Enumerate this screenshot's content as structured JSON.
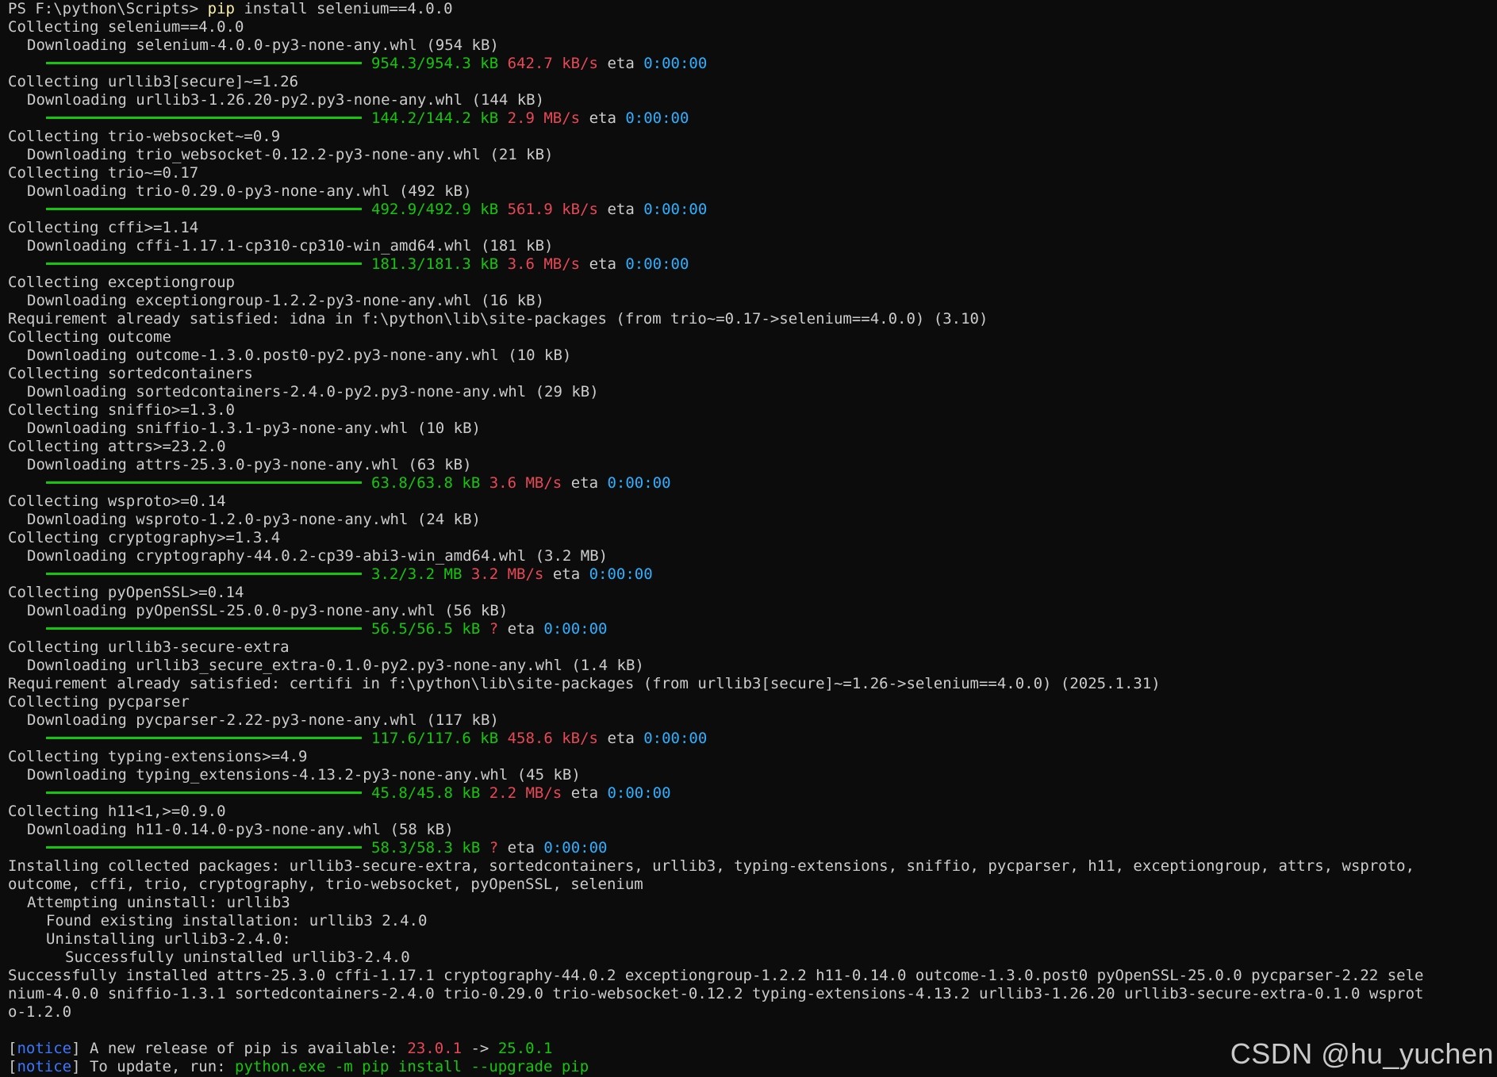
{
  "prompt": {
    "ps_prefix": "PS F:\\python\\Scripts> ",
    "command_name": "pip",
    "command_args": " install selenium==4.0.0"
  },
  "lines": [
    {
      "type": "text",
      "indent": 0,
      "text": "Collecting selenium==4.0.0"
    },
    {
      "type": "text",
      "indent": 1,
      "text": "Downloading selenium-4.0.0-py3-none-any.whl (954 kB)"
    },
    {
      "type": "progress",
      "size": "954.3/954.3 kB",
      "speed": "642.7 kB/s",
      "eta_label": "eta",
      "eta": "0:00:00"
    },
    {
      "type": "text",
      "indent": 0,
      "text": "Collecting urllib3[secure]~=1.26"
    },
    {
      "type": "text",
      "indent": 1,
      "text": "Downloading urllib3-1.26.20-py2.py3-none-any.whl (144 kB)"
    },
    {
      "type": "progress",
      "size": "144.2/144.2 kB",
      "speed": "2.9 MB/s",
      "eta_label": "eta",
      "eta": "0:00:00"
    },
    {
      "type": "text",
      "indent": 0,
      "text": "Collecting trio-websocket~=0.9"
    },
    {
      "type": "text",
      "indent": 1,
      "text": "Downloading trio_websocket-0.12.2-py3-none-any.whl (21 kB)"
    },
    {
      "type": "text",
      "indent": 0,
      "text": "Collecting trio~=0.17"
    },
    {
      "type": "text",
      "indent": 1,
      "text": "Downloading trio-0.29.0-py3-none-any.whl (492 kB)"
    },
    {
      "type": "progress",
      "size": "492.9/492.9 kB",
      "speed": "561.9 kB/s",
      "eta_label": "eta",
      "eta": "0:00:00"
    },
    {
      "type": "text",
      "indent": 0,
      "text": "Collecting cffi>=1.14"
    },
    {
      "type": "text",
      "indent": 1,
      "text": "Downloading cffi-1.17.1-cp310-cp310-win_amd64.whl (181 kB)"
    },
    {
      "type": "progress",
      "size": "181.3/181.3 kB",
      "speed": "3.6 MB/s",
      "eta_label": "eta",
      "eta": "0:00:00"
    },
    {
      "type": "text",
      "indent": 0,
      "text": "Collecting exceptiongroup"
    },
    {
      "type": "text",
      "indent": 1,
      "text": "Downloading exceptiongroup-1.2.2-py3-none-any.whl (16 kB)"
    },
    {
      "type": "text",
      "indent": 0,
      "text": "Requirement already satisfied: idna in f:\\python\\lib\\site-packages (from trio~=0.17->selenium==4.0.0) (3.10)"
    },
    {
      "type": "text",
      "indent": 0,
      "text": "Collecting outcome"
    },
    {
      "type": "text",
      "indent": 1,
      "text": "Downloading outcome-1.3.0.post0-py2.py3-none-any.whl (10 kB)"
    },
    {
      "type": "text",
      "indent": 0,
      "text": "Collecting sortedcontainers"
    },
    {
      "type": "text",
      "indent": 1,
      "text": "Downloading sortedcontainers-2.4.0-py2.py3-none-any.whl (29 kB)"
    },
    {
      "type": "text",
      "indent": 0,
      "text": "Collecting sniffio>=1.3.0"
    },
    {
      "type": "text",
      "indent": 1,
      "text": "Downloading sniffio-1.3.1-py3-none-any.whl (10 kB)"
    },
    {
      "type": "text",
      "indent": 0,
      "text": "Collecting attrs>=23.2.0"
    },
    {
      "type": "text",
      "indent": 1,
      "text": "Downloading attrs-25.3.0-py3-none-any.whl (63 kB)"
    },
    {
      "type": "progress",
      "size": "63.8/63.8 kB",
      "speed": "3.6 MB/s",
      "eta_label": "eta",
      "eta": "0:00:00"
    },
    {
      "type": "text",
      "indent": 0,
      "text": "Collecting wsproto>=0.14"
    },
    {
      "type": "text",
      "indent": 1,
      "text": "Downloading wsproto-1.2.0-py3-none-any.whl (24 kB)"
    },
    {
      "type": "text",
      "indent": 0,
      "text": "Collecting cryptography>=1.3.4"
    },
    {
      "type": "text",
      "indent": 1,
      "text": "Downloading cryptography-44.0.2-cp39-abi3-win_amd64.whl (3.2 MB)"
    },
    {
      "type": "progress",
      "size": "3.2/3.2 MB",
      "speed": "3.2 MB/s",
      "eta_label": "eta",
      "eta": "0:00:00"
    },
    {
      "type": "text",
      "indent": 0,
      "text": "Collecting pyOpenSSL>=0.14"
    },
    {
      "type": "text",
      "indent": 1,
      "text": "Downloading pyOpenSSL-25.0.0-py3-none-any.whl (56 kB)"
    },
    {
      "type": "progress",
      "size": "56.5/56.5 kB",
      "speed": "?",
      "eta_label": "eta",
      "eta": "0:00:00"
    },
    {
      "type": "text",
      "indent": 0,
      "text": "Collecting urllib3-secure-extra"
    },
    {
      "type": "text",
      "indent": 1,
      "text": "Downloading urllib3_secure_extra-0.1.0-py2.py3-none-any.whl (1.4 kB)"
    },
    {
      "type": "text",
      "indent": 0,
      "text": "Requirement already satisfied: certifi in f:\\python\\lib\\site-packages (from urllib3[secure]~=1.26->selenium==4.0.0) (2025.1.31)"
    },
    {
      "type": "text",
      "indent": 0,
      "text": "Collecting pycparser"
    },
    {
      "type": "text",
      "indent": 1,
      "text": "Downloading pycparser-2.22-py3-none-any.whl (117 kB)"
    },
    {
      "type": "progress",
      "size": "117.6/117.6 kB",
      "speed": "458.6 kB/s",
      "eta_label": "eta",
      "eta": "0:00:00"
    },
    {
      "type": "text",
      "indent": 0,
      "text": "Collecting typing-extensions>=4.9"
    },
    {
      "type": "text",
      "indent": 1,
      "text": "Downloading typing_extensions-4.13.2-py3-none-any.whl (45 kB)"
    },
    {
      "type": "progress",
      "size": "45.8/45.8 kB",
      "speed": "2.2 MB/s",
      "eta_label": "eta",
      "eta": "0:00:00"
    },
    {
      "type": "text",
      "indent": 0,
      "text": "Collecting h11<1,>=0.9.0"
    },
    {
      "type": "text",
      "indent": 1,
      "text": "Downloading h11-0.14.0-py3-none-any.whl (58 kB)"
    },
    {
      "type": "progress",
      "size": "58.3/58.3 kB",
      "speed": "?",
      "eta_label": "eta",
      "eta": "0:00:00"
    },
    {
      "type": "text",
      "indent": 0,
      "text": "Installing collected packages: urllib3-secure-extra, sortedcontainers, urllib3, typing-extensions, sniffio, pycparser, h11, exceptiongroup, attrs, wsproto,"
    },
    {
      "type": "text",
      "indent": 0,
      "text": "outcome, cffi, trio, cryptography, trio-websocket, pyOpenSSL, selenium"
    },
    {
      "type": "text",
      "indent": 1,
      "text": "Attempting uninstall: urllib3"
    },
    {
      "type": "text",
      "indent": 2,
      "text": "Found existing installation: urllib3 2.4.0"
    },
    {
      "type": "text",
      "indent": 2,
      "text": "Uninstalling urllib3-2.4.0:"
    },
    {
      "type": "text",
      "indent": 3,
      "text": "Successfully uninstalled urllib3-2.4.0"
    },
    {
      "type": "text",
      "indent": 0,
      "text": "Successfully installed attrs-25.3.0 cffi-1.17.1 cryptography-44.0.2 exceptiongroup-1.2.2 h11-0.14.0 outcome-1.3.0.post0 pyOpenSSL-25.0.0 pycparser-2.22 sele"
    },
    {
      "type": "text",
      "indent": 0,
      "text": "nium-4.0.0 sniffio-1.3.1 sortedcontainers-2.4.0 trio-0.29.0 trio-websocket-0.12.2 typing-extensions-4.13.2 urllib3-1.26.20 urllib3-secure-extra-0.1.0 wsprot"
    },
    {
      "type": "text",
      "indent": 0,
      "text": "o-1.2.0"
    },
    {
      "type": "blank"
    },
    {
      "type": "notice_release",
      "notice": "notice",
      "text": "A new release of pip is available:",
      "old_version": "23.0.1",
      "arrow": "->",
      "new_version": "25.0.1"
    },
    {
      "type": "notice_update",
      "notice": "notice",
      "text": "To update, run:",
      "command": "python.exe -m pip install --upgrade pip"
    }
  ],
  "watermark": "CSDN @hu_yuchen",
  "colors": {
    "background": "#0c0c0c",
    "foreground": "#cccccc",
    "progress_bar": "#16c60c",
    "size": "#16c60c",
    "speed": "#e74856",
    "eta": "#2db0ff",
    "command": "#f9f1a5",
    "notice": "#3b78ff"
  }
}
